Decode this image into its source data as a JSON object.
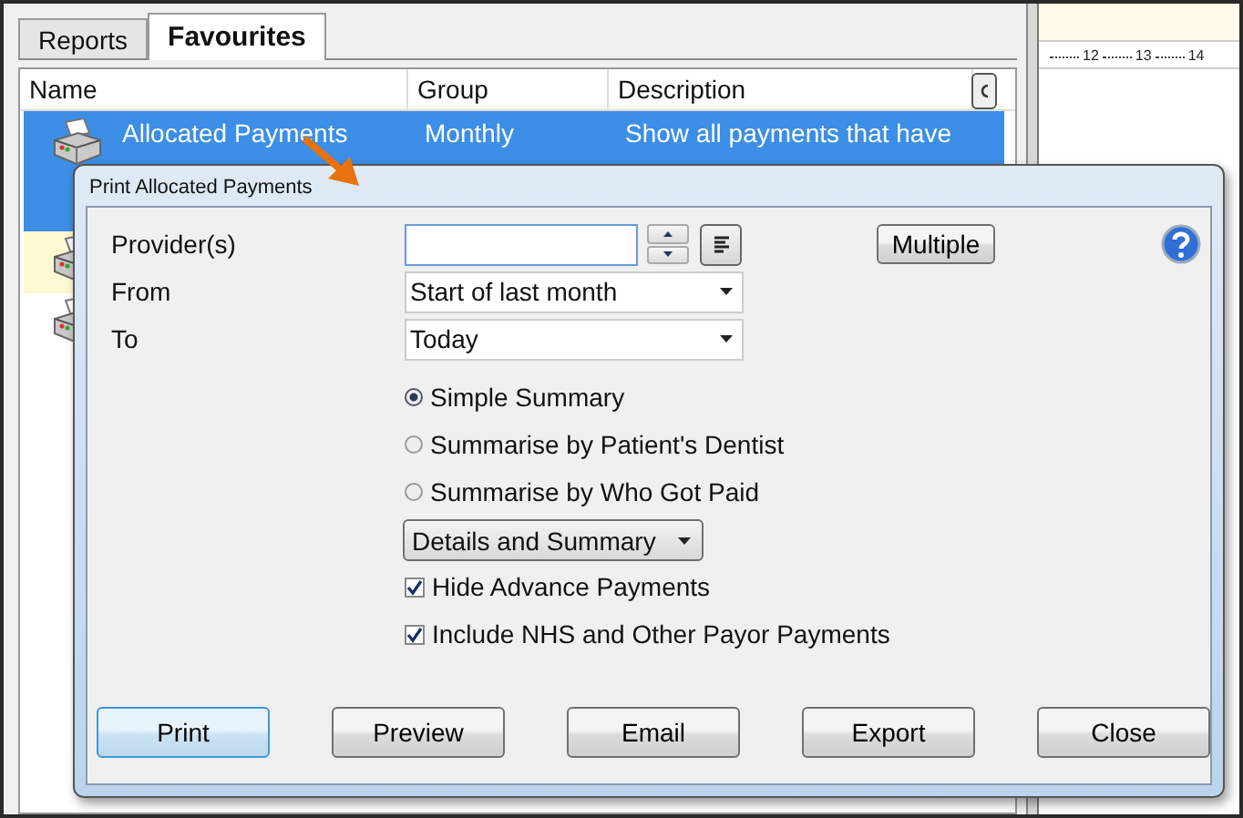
{
  "list_window": {
    "tabs": [
      {
        "label": "Reports",
        "selected": false
      },
      {
        "label": "Favourites",
        "selected": true
      }
    ],
    "columns": [
      "Name",
      "Group",
      "Description"
    ],
    "rows": [
      {
        "name": "Allocated Payments",
        "group": "Monthly",
        "description": "Show all payments that have",
        "selected": true,
        "highlighted": false
      },
      {
        "selected": false,
        "highlighted": true
      },
      {
        "selected": false,
        "highlighted": false
      }
    ]
  },
  "ruler": {
    "labels": [
      "12",
      "13",
      "14"
    ]
  },
  "dialog": {
    "title": "Print Allocated Payments",
    "provider": {
      "label": "Provider(s)"
    },
    "from": {
      "label": "From",
      "value": "Start of last month"
    },
    "to": {
      "label": "To",
      "value": "Today"
    },
    "multiple_button": "Multiple",
    "summary_options": [
      {
        "label": "Simple Summary",
        "selected": true
      },
      {
        "label": "Summarise by Patient's Dentist",
        "selected": false
      },
      {
        "label": "Summarise by Who Got Paid",
        "selected": false
      }
    ],
    "detail_dropdown": "Details and Summary",
    "options": [
      {
        "label": "Hide Advance Payments",
        "checked": true
      },
      {
        "label": "Include NHS and Other Payor Payments",
        "checked": true
      }
    ],
    "buttons": [
      {
        "label": "Print",
        "default": true
      },
      {
        "label": "Preview",
        "default": false
      },
      {
        "label": "Email",
        "default": false
      },
      {
        "label": "Export",
        "default": false
      },
      {
        "label": "Close",
        "default": false
      }
    ]
  }
}
